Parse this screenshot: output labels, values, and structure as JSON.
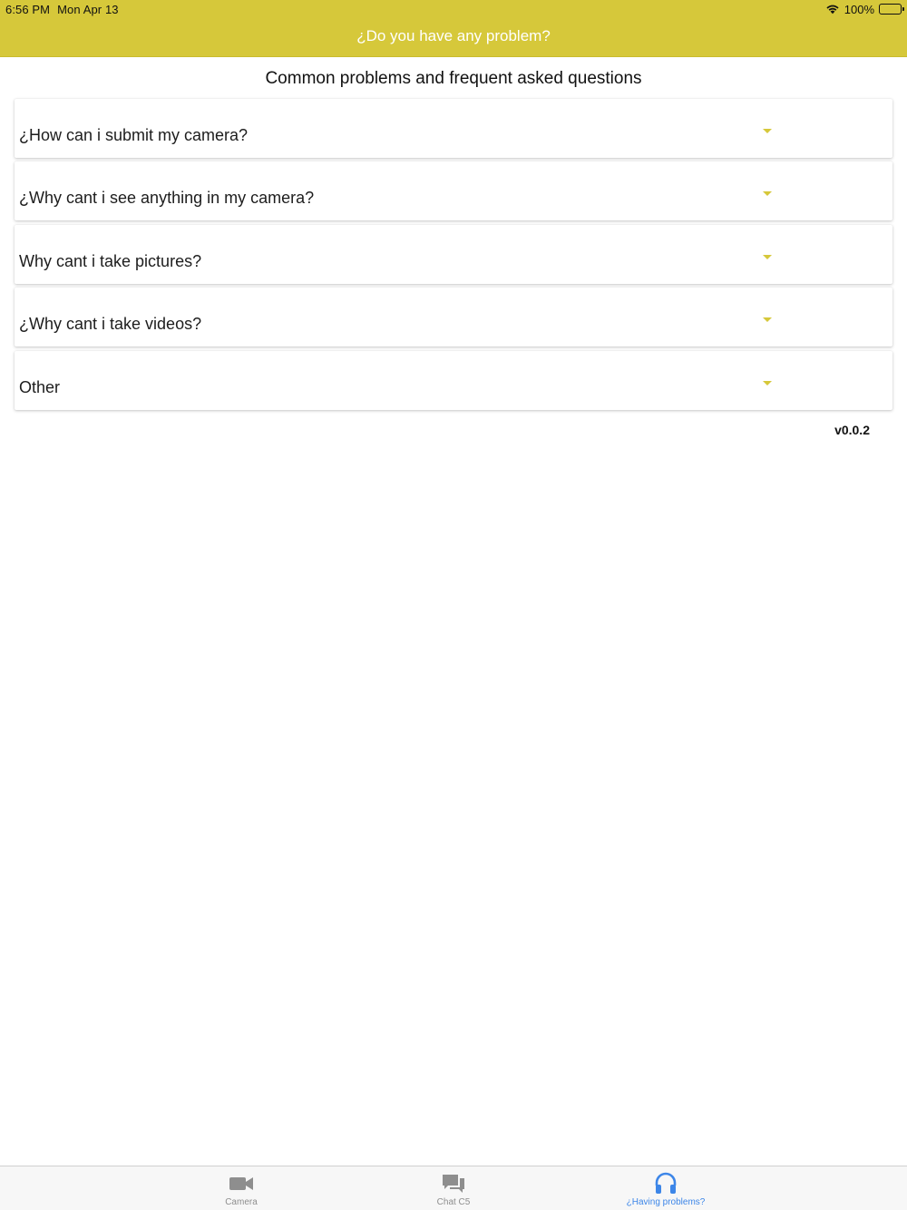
{
  "status_bar": {
    "time": "6:56 PM",
    "date": "Mon Apr 13",
    "battery": "100%"
  },
  "header": {
    "title": "¿Do you have any problem?"
  },
  "main": {
    "heading": "Common problems and frequent asked questions",
    "faq": [
      {
        "question": "¿How can i submit my camera?"
      },
      {
        "question": "¿Why cant i see anything in my camera?"
      },
      {
        "question": "Why cant i take pictures?"
      },
      {
        "question": "¿Why cant i take videos?"
      },
      {
        "question": "Other"
      }
    ],
    "version": "v0.0.2"
  },
  "tabbar": {
    "tabs": [
      {
        "label": "Camera",
        "icon": "video-camera-icon",
        "active": false
      },
      {
        "label": "Chat C5",
        "icon": "chat-bubbles-icon",
        "active": false
      },
      {
        "label": "¿Having problems?",
        "icon": "headphones-icon",
        "active": true
      }
    ]
  },
  "colors": {
    "accent": "#d6c83a",
    "tab_active": "#3d86e8",
    "tab_inactive": "#8e8e8e"
  }
}
